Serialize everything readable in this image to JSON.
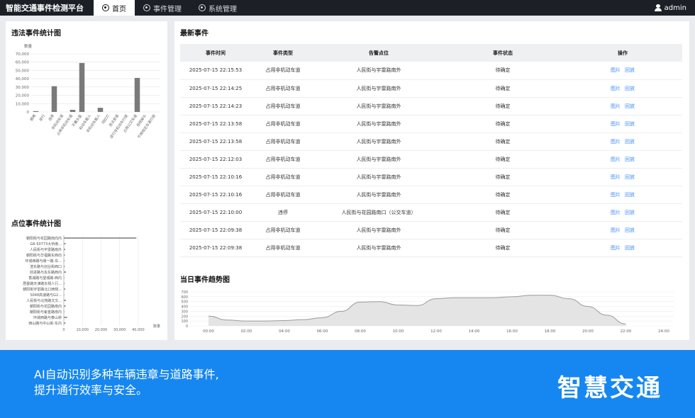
{
  "nav": {
    "brand": "智能交通事件检测平台",
    "items": [
      {
        "label": "首页",
        "icon": "home-icon"
      },
      {
        "label": "事件管理",
        "icon": "gear-icon"
      },
      {
        "label": "系统管理",
        "icon": "gear-icon"
      }
    ],
    "user": "admin"
  },
  "violation_panel": {
    "title": "违法事件统计图"
  },
  "location_panel": {
    "title": "点位事件统计图"
  },
  "events_panel": {
    "title": "最新事件",
    "columns": [
      "事件时间",
      "事件类型",
      "告警点位",
      "事件状态",
      "操作"
    ],
    "action_labels": [
      "图片",
      "回放"
    ],
    "rows": [
      {
        "time": "2025-07-15 22:15:53",
        "type": "占用非机动车道",
        "location": "人民街与宇雷路南外",
        "status": "待确定"
      },
      {
        "time": "2025-07-15 22:14:25",
        "type": "占用非机动车道",
        "location": "人民街与宇雷路南外",
        "status": "待确定"
      },
      {
        "time": "2025-07-15 22:14:23",
        "type": "占用非机动车道",
        "location": "人民街与宇雷路南外",
        "status": "待确定"
      },
      {
        "time": "2025-07-15 22:13:58",
        "type": "占用非机动车道",
        "location": "人民街与宇雷路南外",
        "status": "待确定"
      },
      {
        "time": "2025-07-15 22:13:58",
        "type": "占用非机动车道",
        "location": "人民街与宇雷路南外",
        "status": "待确定"
      },
      {
        "time": "2025-07-15 22:12:03",
        "type": "占用非机动车道",
        "location": "人民街与宇雷路南外",
        "status": "待确定"
      },
      {
        "time": "2025-07-15 22:10:16",
        "type": "占用非机动车道",
        "location": "人民街与宇雷路南外",
        "status": "待确定"
      },
      {
        "time": "2025-07-15 22:10:16",
        "type": "占用非机动车道",
        "location": "人民街与宇雷路南外",
        "status": "待确定"
      },
      {
        "time": "2025-07-15 22:10:00",
        "type": "违停",
        "location": "人民街与花园路南口（公交车道）",
        "status": "待确定"
      },
      {
        "time": "2025-07-15 22:09:38",
        "type": "占用非机动车道",
        "location": "人民街与宇雷路南外",
        "status": "待确定"
      },
      {
        "time": "2025-07-15 22:09:38",
        "type": "占用非机动车道",
        "location": "人民街与宇雷路南外",
        "status": "待确定"
      }
    ]
  },
  "trend_panel": {
    "title": "当日事件趋势图"
  },
  "banner": {
    "line1": "AI自动识别多种车辆违章与道路事件,",
    "line2": "提升通行效率与安全。",
    "brand": "智慧交通"
  },
  "colors": {
    "nav_bg": "#1c2026",
    "bar": "#7a7a7a",
    "link": "#3d8bf5",
    "banner": "#1687f0"
  },
  "chart_data": [
    {
      "type": "bar",
      "ylabel": "数量",
      "ylim": [
        0,
        70000
      ],
      "yticks": [
        "0",
        "10,000",
        "20,000",
        "30,000",
        "40,000",
        "50,000",
        "60,000",
        "70,000"
      ],
      "categories": [
        "拥堵",
        "逆行",
        "违停",
        "非机动车道",
        "占用非机动车道",
        "不戴头盔",
        "机动车载人",
        "非机动车载人",
        "闯红灯",
        "违法变道",
        "逆行非机动车行驶",
        "占用公交车道",
        "违规掉头",
        "不按规定车道行驶"
      ],
      "values": [
        1000,
        0,
        31000,
        0,
        2500,
        59000,
        0,
        5000,
        0,
        0,
        0,
        41000,
        0,
        0
      ]
    },
    {
      "type": "bar",
      "orientation": "horizontal",
      "xlabel": "数量",
      "xticks": [
        "0",
        "10,000",
        "20,000",
        "30,000",
        "40,000"
      ],
      "xlim": [
        0,
        45000
      ],
      "categories": [
        "朝阳街与花园路南向内",
        "G6-50773大桥南...",
        "人民街与宇雷路南外",
        "朝阳街与华福路东西向",
        "环城西路与峨一路-东...",
        "渣东路与创业街西口",
        "前进路与永东路西内",
        "香湖路与望城路-西内",
        "居委路天津路东侧人行...",
        "朝阳街宇雷路北口西侧...",
        "S048高速路与G2...",
        "人民街与北苑路文文...",
        "朝阳街与花园路南内",
        "朝阳街与紫金路南内",
        "环城西路与泰山桥",
        "西山路与中山街-东内"
      ],
      "values": [
        39000,
        1000,
        800,
        600,
        400,
        500,
        1200,
        300,
        400,
        800,
        300,
        1200,
        1000,
        300,
        1800,
        900
      ]
    },
    {
      "type": "area",
      "ylim": [
        0,
        700
      ],
      "yticks": [
        "0",
        "100",
        "200",
        "300",
        "400",
        "500",
        "600",
        "700"
      ],
      "xticks": [
        "00:00",
        "02:00",
        "04:00",
        "06:00",
        "08:00",
        "10:00",
        "12:00",
        "14:00",
        "16:00",
        "18:00",
        "20:00",
        "22:00",
        "24:00"
      ],
      "x": [
        0,
        1,
        2,
        3,
        4,
        5,
        6,
        7,
        8,
        9,
        10,
        11,
        12,
        13,
        14,
        15,
        16,
        17,
        18,
        19,
        20,
        21,
        22
      ],
      "values": [
        200,
        120,
        100,
        100,
        110,
        130,
        170,
        300,
        490,
        500,
        430,
        420,
        560,
        580,
        580,
        580,
        600,
        630,
        630,
        560,
        400,
        220,
        40
      ]
    }
  ]
}
